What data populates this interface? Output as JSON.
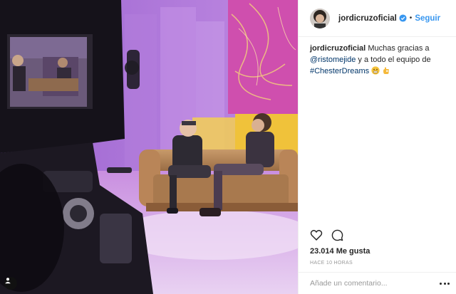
{
  "post": {
    "username": "jordicruzoficial",
    "separator": "•",
    "follow_label": "Seguir",
    "caption": {
      "text_1": "Muchas gracias a",
      "mention": "@ristomejide",
      "text_2": "y a todo el equipo de",
      "hashtag": "#ChesterDreams"
    },
    "likes": "23.014 Me gusta",
    "timestamp": "HACE 10 HORAS",
    "comment_placeholder": "Añade un comentario..."
  },
  "colors": {
    "follow_blue": "#3897f0",
    "link_navy": "#003569",
    "verified_blue": "#3897f0"
  },
  "icons": [
    "verified-icon",
    "heart-icon",
    "comment-icon",
    "more-options-icon",
    "user-tag-icon",
    "grimace-emoji",
    "ok-hand-emoji"
  ]
}
